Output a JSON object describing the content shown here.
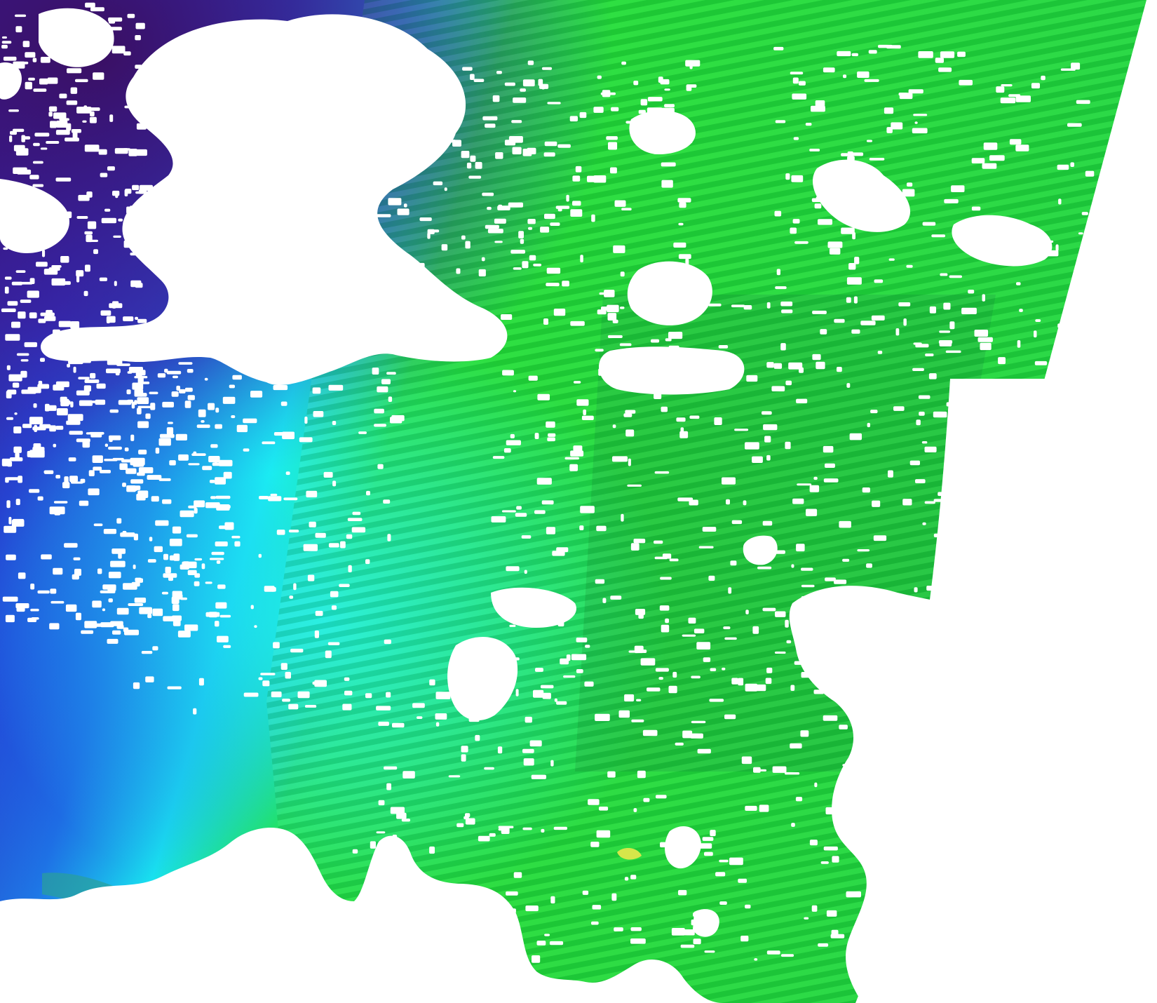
{
  "map": {
    "kind": "satellite swath raster",
    "labels": [],
    "colors": {
      "background": "#ffffff",
      "no_data": "#ffffff",
      "palette_low": "#3a1170",
      "palette_deep_blue": "#2a3cc8",
      "palette_blue": "#1e78e6",
      "palette_cyan": "#18e8f0",
      "palette_green": "#22dc34",
      "palette_dark_green": "#16a83a",
      "palette_yellow": "#f4f01c",
      "palette_orange": "#ffb800"
    },
    "swath_striping": true
  }
}
